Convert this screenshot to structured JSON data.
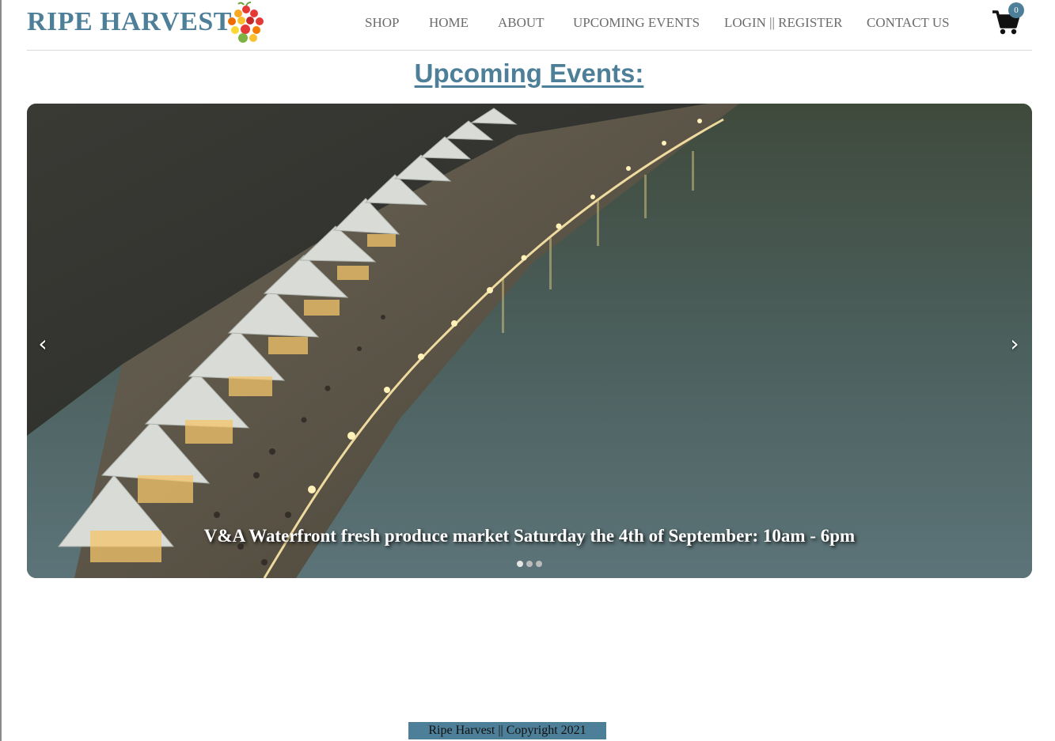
{
  "brand": {
    "name": "RIPE HARVEST",
    "logo_icon": "fruit-cluster-icon"
  },
  "nav": {
    "items": [
      {
        "label": "SHOP"
      },
      {
        "label": "HOME"
      },
      {
        "label": "ABOUT"
      },
      {
        "label": "UPCOMING EVENTS"
      },
      {
        "label": "LOGIN || REGISTER"
      },
      {
        "label": "CONTACT US"
      }
    ],
    "cart_icon": "shopping-cart-icon",
    "cart_count": "0"
  },
  "page": {
    "title": "Upcoming Events:"
  },
  "carousel": {
    "prev_label": "‹",
    "next_label": "›",
    "caption": "V&A Waterfront fresh produce market Saturday the 4th of September: 10am - 6pm",
    "slide_count": 3,
    "active_index": 0
  },
  "footer": {
    "text": "Ripe Harvest || Copyright 2021"
  },
  "colors": {
    "accent": "#4e7f98",
    "nav_text": "#6b6b6b"
  }
}
